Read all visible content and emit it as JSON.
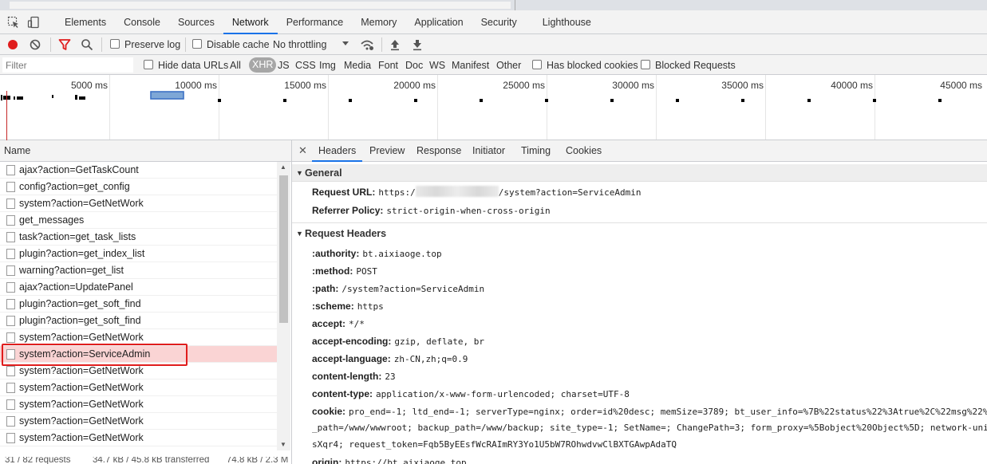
{
  "devtools": {
    "tabs": [
      "Elements",
      "Console",
      "Sources",
      "Network",
      "Performance",
      "Memory",
      "Application",
      "Security",
      "Lighthouse"
    ],
    "active_tab": "Network"
  },
  "toolbar": {
    "preserve_log": "Preserve log",
    "disable_cache": "Disable cache",
    "throttling": "No throttling"
  },
  "filterbar": {
    "placeholder": "Filter",
    "hide_data_urls": "Hide data URLs",
    "types": [
      "All",
      "XHR",
      "JS",
      "CSS",
      "Img",
      "Media",
      "Font",
      "Doc",
      "WS",
      "Manifest",
      "Other"
    ],
    "active_type": "XHR",
    "has_blocked_cookies": "Has blocked cookies",
    "blocked_requests": "Blocked Requests"
  },
  "overview": {
    "ticks": [
      "5000 ms",
      "10000 ms",
      "15000 ms",
      "20000 ms",
      "25000 ms",
      "30000 ms",
      "35000 ms",
      "40000 ms",
      "45000 ms"
    ]
  },
  "requests": {
    "header": "Name",
    "items": [
      "ajax?action=GetTaskCount",
      "config?action=get_config",
      "system?action=GetNetWork",
      "get_messages",
      "task?action=get_task_lists",
      "plugin?action=get_index_list",
      "warning?action=get_list",
      "ajax?action=UpdatePanel",
      "plugin?action=get_soft_find",
      "plugin?action=get_soft_find",
      "system?action=GetNetWork",
      "system?action=ServiceAdmin",
      "system?action=GetNetWork",
      "system?action=GetNetWork",
      "system?action=GetNetWork",
      "system?action=GetNetWork",
      "system?action=GetNetWork"
    ],
    "selected": "system?action=ServiceAdmin",
    "status": [
      "31 / 82 requests",
      "34.7 kB / 45.8 kB transferred",
      "74.8 kB / 2.3 M"
    ]
  },
  "details": {
    "tabs": [
      "Headers",
      "Preview",
      "Response",
      "Initiator",
      "Timing",
      "Cookies"
    ],
    "active_tab": "Headers",
    "general": {
      "title": "General",
      "request_url_key": "Request URL:",
      "request_url_prefix": "https:/",
      "request_url_suffix": "/system?action=ServiceAdmin",
      "referrer_key": "Referrer Policy:",
      "referrer_val": "strict-origin-when-cross-origin"
    },
    "request_headers": {
      "title": "Request Headers",
      "rows": [
        {
          "k": ":authority:",
          "v": "bt.aixiaoge.top"
        },
        {
          "k": ":method:",
          "v": "POST"
        },
        {
          "k": ":path:",
          "v": "/system?action=ServiceAdmin"
        },
        {
          "k": ":scheme:",
          "v": "https"
        },
        {
          "k": "accept:",
          "v": "*/*"
        },
        {
          "k": "accept-encoding:",
          "v": "gzip, deflate, br"
        },
        {
          "k": "accept-language:",
          "v": "zh-CN,zh;q=0.9"
        },
        {
          "k": "content-length:",
          "v": "23"
        },
        {
          "k": "content-type:",
          "v": "application/x-www-form-urlencoded; charset=UTF-8"
        },
        {
          "k": "cookie:",
          "v": "pro_end=-1; ltd_end=-1; serverType=nginx; order=id%20desc; memSize=3789; bt_user_info=%7B%22status%22%3Atrue%2C%22msg%22%"
        }
      ],
      "cookie_line2": "_path=/www/wwwroot; backup_path=/www/backup; site_type=-1; SetName=; ChangePath=3; form_proxy=%5Bobject%20Object%5D; network-unit",
      "cookie_line3": "sXqr4; request_token=Fqb5ByEEsfWcRAImRY3Yo1U5bW7ROhwdvwClBXTGAwpAdaTQ",
      "origin": {
        "k": "origin:",
        "v": "https://bt.aixiaoge.top"
      }
    }
  }
}
